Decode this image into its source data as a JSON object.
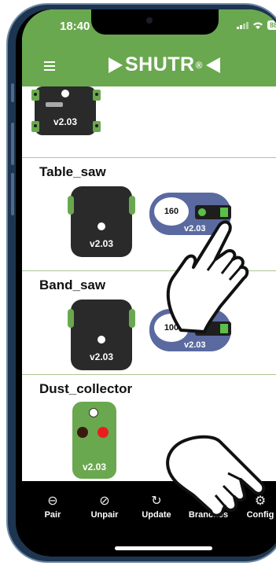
{
  "status_bar": {
    "time": "18:40",
    "battery": "88"
  },
  "header": {
    "logo_text": "SHUTR",
    "logo_mark": "®"
  },
  "devices": [
    {
      "name": "",
      "hub_version": "v2.03"
    },
    {
      "name": "Table_saw",
      "hub_version": "v2.03",
      "remote_value": "160",
      "remote_version": "v2.03"
    },
    {
      "name": "Band_saw",
      "hub_version": "v2.03",
      "remote_value": "100",
      "remote_version": "v2.03"
    },
    {
      "name": "Dust_collector",
      "hub_version": "v2.03"
    }
  ],
  "nav": {
    "items": [
      {
        "label": "Pair",
        "icon": "link-icon"
      },
      {
        "label": "Unpair",
        "icon": "unlink-icon"
      },
      {
        "label": "Update",
        "icon": "refresh-icon"
      },
      {
        "label": "Branches",
        "icon": "branches-icon"
      },
      {
        "label": "Config",
        "icon": "gear-icon"
      }
    ]
  },
  "colors": {
    "header_green": "#6aa84f",
    "remote_blue": "#5a6aa0",
    "dark_chip": "#2a2a2a",
    "led_red": "#e81e1e",
    "led_dark": "#3a1a10"
  }
}
